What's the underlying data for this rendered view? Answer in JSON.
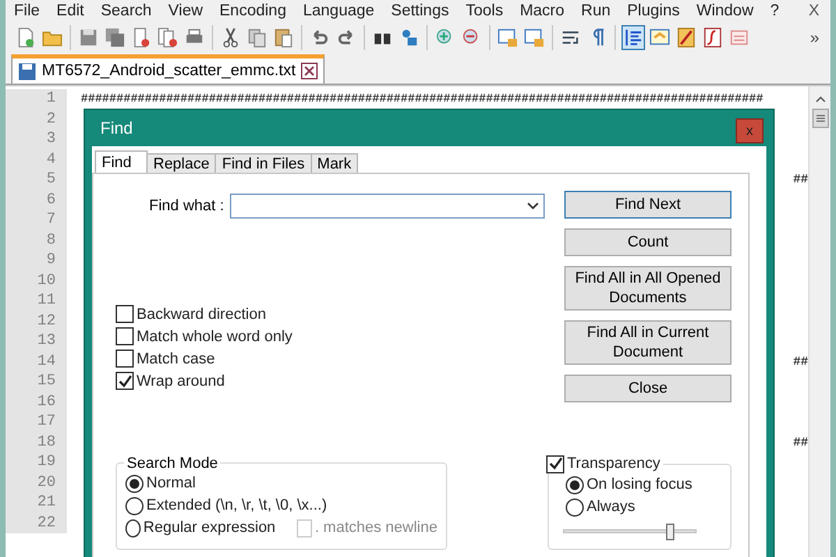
{
  "menu": [
    "File",
    "Edit",
    "Search",
    "View",
    "Encoding",
    "Language",
    "Settings",
    "Tools",
    "Macro",
    "Run",
    "Plugins",
    "Window",
    "?"
  ],
  "menu_close": "X",
  "toolbar_more": "»",
  "file_tab": {
    "label": "MT6572_Android_scatter_emmc.txt",
    "selected": true
  },
  "editor": {
    "lines": [
      {
        "number": "1",
        "left": "################################################################################################"
      },
      {
        "number": "2"
      },
      {
        "number": "3"
      },
      {
        "number": "4"
      },
      {
        "number": "5",
        "right": "##"
      },
      {
        "number": "6"
      },
      {
        "number": "7"
      },
      {
        "number": "8"
      },
      {
        "number": "9"
      },
      {
        "number": "10"
      },
      {
        "number": "11"
      },
      {
        "number": "12"
      },
      {
        "number": "13"
      },
      {
        "number": "14",
        "right": "##"
      },
      {
        "number": "15"
      },
      {
        "number": "16"
      },
      {
        "number": "17"
      },
      {
        "number": "18",
        "right": "##"
      },
      {
        "number": "19"
      },
      {
        "number": "20"
      },
      {
        "number": "21"
      },
      {
        "number": "22"
      }
    ]
  },
  "dialog": {
    "title": "Find",
    "close": "x",
    "tabs": [
      {
        "label": "Find",
        "selected": true
      },
      {
        "label": "Replace",
        "selected": false
      },
      {
        "label": "Find in Files",
        "selected": false
      },
      {
        "label": "Mark",
        "selected": false
      }
    ],
    "find_what": {
      "label": "Find what :"
    },
    "buttons": [
      {
        "label": "Find Next",
        "default": true
      },
      {
        "label": "Count",
        "default": false
      },
      {
        "label": "Find All in All Opened Documents",
        "default": false
      },
      {
        "label": "Find All in Current Document",
        "default": false
      },
      {
        "label": "Close",
        "default": false
      }
    ],
    "options": [
      {
        "label": "Backward direction",
        "checked": false
      },
      {
        "label": "Match whole word only",
        "checked": false
      },
      {
        "label": "Match case",
        "checked": false
      },
      {
        "label": "Wrap around",
        "checked": true
      }
    ],
    "search_mode": {
      "title": "Search Mode",
      "modes": [
        {
          "label": "Normal",
          "selected": true
        },
        {
          "label": "Extended (\\n, \\r, \\t, \\0, \\x...)",
          "selected": false
        },
        {
          "label": "Regular expression",
          "selected": false
        }
      ],
      "dot_newline": {
        "label": ". matches newline",
        "checked": false,
        "disabled": true
      }
    },
    "transparency": {
      "label": "Transparency",
      "checked": true,
      "modes": [
        {
          "label": "On losing focus",
          "selected": true
        },
        {
          "label": "Always",
          "selected": false
        }
      ],
      "level": 0.8
    }
  }
}
